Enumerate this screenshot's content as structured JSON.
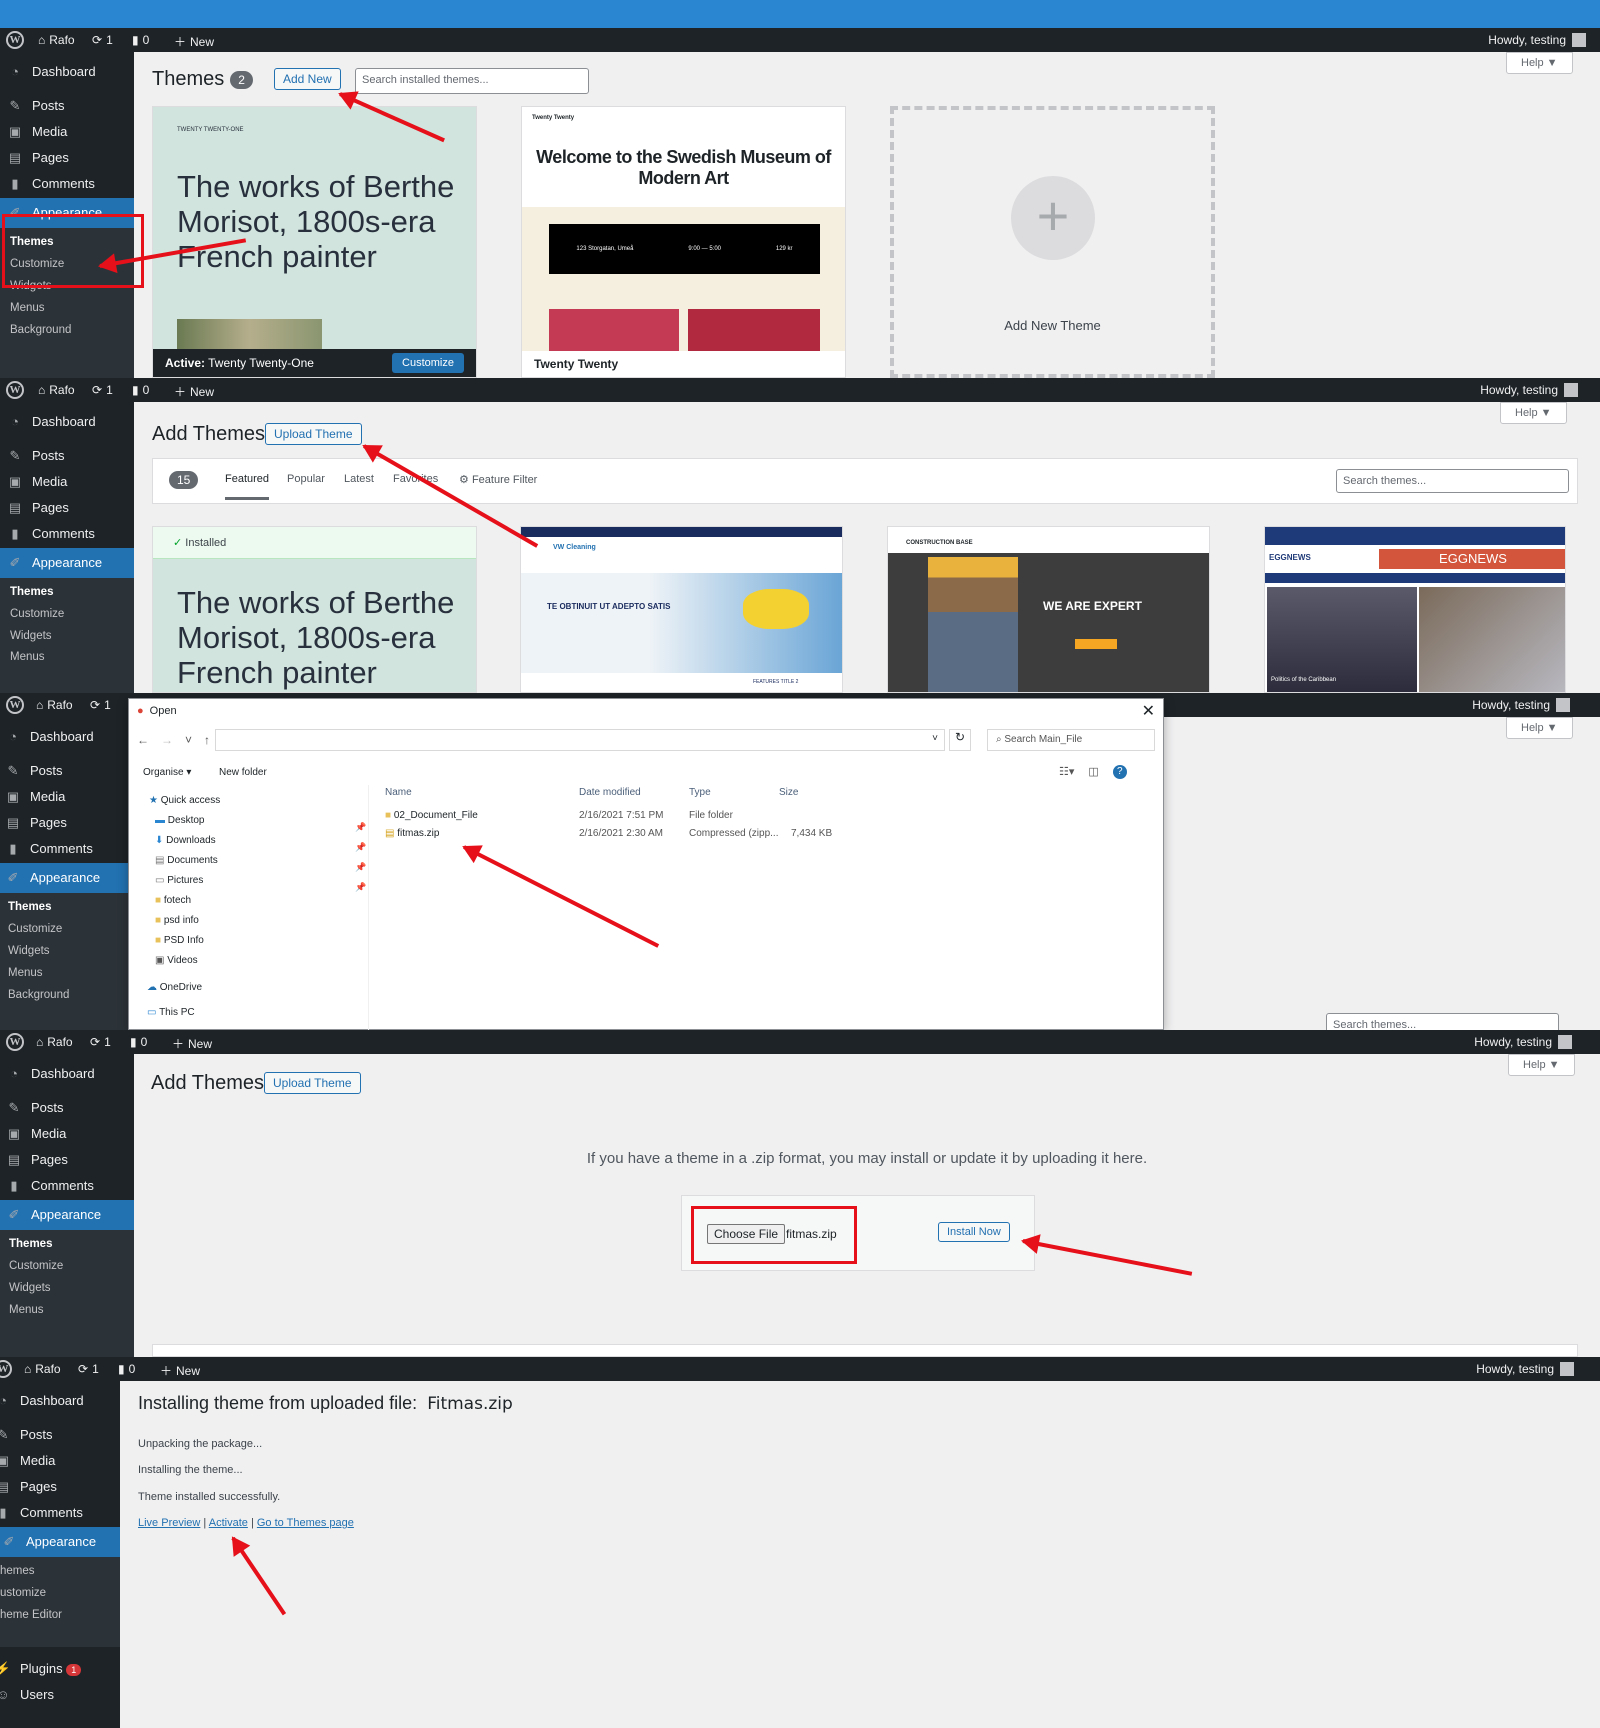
{
  "colors": {
    "accent": "#2271b1",
    "admin_bar": "#1d2327",
    "annotation": "#e5101a",
    "highlight": "#2b86d1"
  },
  "admin_bar": {
    "site": "Rafo",
    "updates": "1",
    "comments": "0",
    "new": "New",
    "howdy": "Howdy, testing"
  },
  "menu": {
    "dashboard": "Dashboard",
    "posts": "Posts",
    "media": "Media",
    "pages": "Pages",
    "comments": "Comments",
    "appearance": "Appearance",
    "themes": "Themes",
    "customize": "Customize",
    "widgets": "Widgets",
    "menus": "Menus",
    "background": "Background",
    "theme_editor": "Theme Editor",
    "plugins": "Plugins",
    "plugins_badge": "1",
    "users": "Users",
    "menus_cut": "Menus",
    "background_cut": "Background",
    "themes_cut": "hemes",
    "customize_cut": "ustomize",
    "theme_editor_cut": "heme Editor"
  },
  "help": "Help ▼",
  "step1": {
    "title": "Themes",
    "count": "2",
    "add_new": "Add New",
    "search_placeholder": "Search installed themes...",
    "theme1": {
      "small": "TWENTY TWENTY-ONE",
      "headline": "The works of Berthe Morisot, 1800s-era French painter",
      "active_label": "Active:",
      "active_name": "Twenty Twenty-One",
      "customize": "Customize"
    },
    "theme2": {
      "small": "Twenty Twenty",
      "headline": "Welcome to the Swedish Museum of Modern Art",
      "name": "Twenty Twenty",
      "table": [
        "123 Storgatan, Umeå",
        "9:00 — 5:00",
        "129 kr"
      ]
    },
    "add_new_theme": "Add New Theme"
  },
  "step2": {
    "title": "Add Themes",
    "upload": "Upload Theme",
    "count": "15",
    "tabs": [
      "Featured",
      "Popular",
      "Latest",
      "Favorites"
    ],
    "feature_filter": "Feature Filter",
    "search_placeholder": "Search themes...",
    "installed": "Installed",
    "headline": "The works of Berthe Morisot, 1800s-era French painter",
    "shot1": {
      "brand": "VW Cleaning",
      "heading": "TE OBTINUIT UT ADEPTO SATIS",
      "feature": "FEATURES TITLE 2"
    },
    "shot2": {
      "brand": "CONSTRUCTION BASE",
      "heading": "WE ARE EXPERT"
    },
    "shot3": {
      "brand": "EGGNEWS",
      "banner": "EGGNEWS",
      "caption": "Politics of the Caribbean"
    }
  },
  "step3": {
    "dialog_title": "Open",
    "search": "Search Main_File",
    "organise": "Organise ▾",
    "new_folder": "New folder",
    "nav": [
      "Quick access",
      "Desktop",
      "Downloads",
      "Documents",
      "Pictures",
      "fotech",
      "psd info",
      "PSD Info",
      "Videos",
      "OneDrive",
      "This PC"
    ],
    "columns": [
      "Name",
      "Date modified",
      "Type",
      "Size"
    ],
    "rows": [
      {
        "name": "02_Document_File",
        "date": "2/16/2021 7:51 PM",
        "type": "File folder",
        "size": ""
      },
      {
        "name": "fitmas.zip",
        "date": "2/16/2021 2:30 AM",
        "type": "Compressed (zipp...",
        "size": "7,434 KB"
      }
    ],
    "search_cut": "Search themes..."
  },
  "step4": {
    "title": "Add Themes",
    "upload": "Upload Theme",
    "description": "If you have a theme in a .zip format, you may install or update it by uploading it here.",
    "choose_file": "Choose File",
    "file_name": "fitmas.zip",
    "install_now": "Install Now"
  },
  "step5": {
    "title_prefix": "Installing theme from uploaded file:",
    "file": "Fitmas.zip",
    "lines": [
      "Unpacking the package...",
      "Installing the theme...",
      "Theme installed successfully."
    ],
    "links": [
      "Live Preview",
      "Activate",
      "Go to Themes page"
    ],
    "sep": "|"
  }
}
